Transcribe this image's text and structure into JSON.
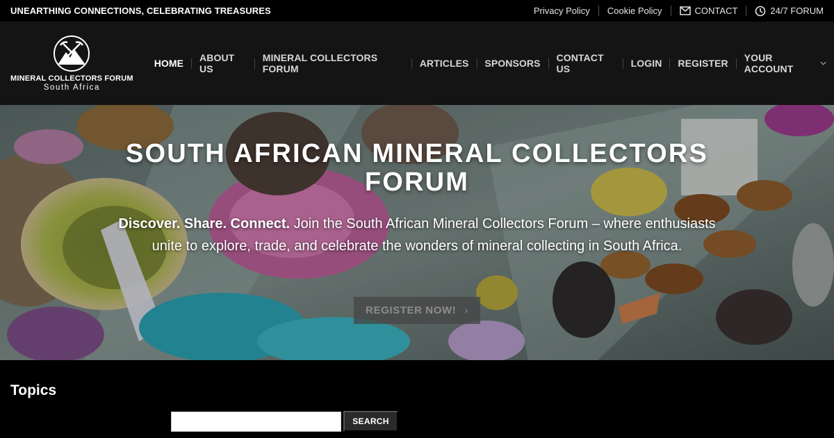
{
  "topbar": {
    "tagline": "UNEARTHING CONNECTIONS, CELEBRATING TREASURES",
    "links": [
      {
        "label": "Privacy Policy",
        "icon": "none"
      },
      {
        "label": "Cookie Policy",
        "icon": "none"
      },
      {
        "label": "CONTACT",
        "icon": "envelope-icon"
      },
      {
        "label": "24/7 FORUM",
        "icon": "clock-icon"
      }
    ]
  },
  "logo": {
    "title": "MINERAL COLLECTORS FORUM",
    "subtitle": "South Africa"
  },
  "nav": {
    "items": [
      {
        "label": "HOME",
        "active": true
      },
      {
        "label": "ABOUT US"
      },
      {
        "label": "MINERAL COLLECTORS FORUM"
      },
      {
        "label": "ARTICLES"
      },
      {
        "label": "SPONSORS"
      },
      {
        "label": "CONTACT US"
      },
      {
        "label": "LOGIN"
      },
      {
        "label": "REGISTER"
      },
      {
        "label": "YOUR ACCOUNT",
        "dropdown": true
      }
    ]
  },
  "hero": {
    "title": "SOUTH AFRICAN MINERAL COLLECTORS FORUM",
    "lead_bold": "Discover. Share. Connect.",
    "lead_text": " Join the South African Mineral Collectors Forum – where enthusiasts unite to explore, trade, and celebrate the wonders of mineral collecting in South Africa.",
    "cta_label": "REGISTER NOW!"
  },
  "topics": {
    "heading": "Topics",
    "search_value": "",
    "search_button": "SEARCH"
  },
  "colors": {
    "topbar_bg": "#000000",
    "header_bg": "#141414",
    "accent": "#ffffff"
  }
}
